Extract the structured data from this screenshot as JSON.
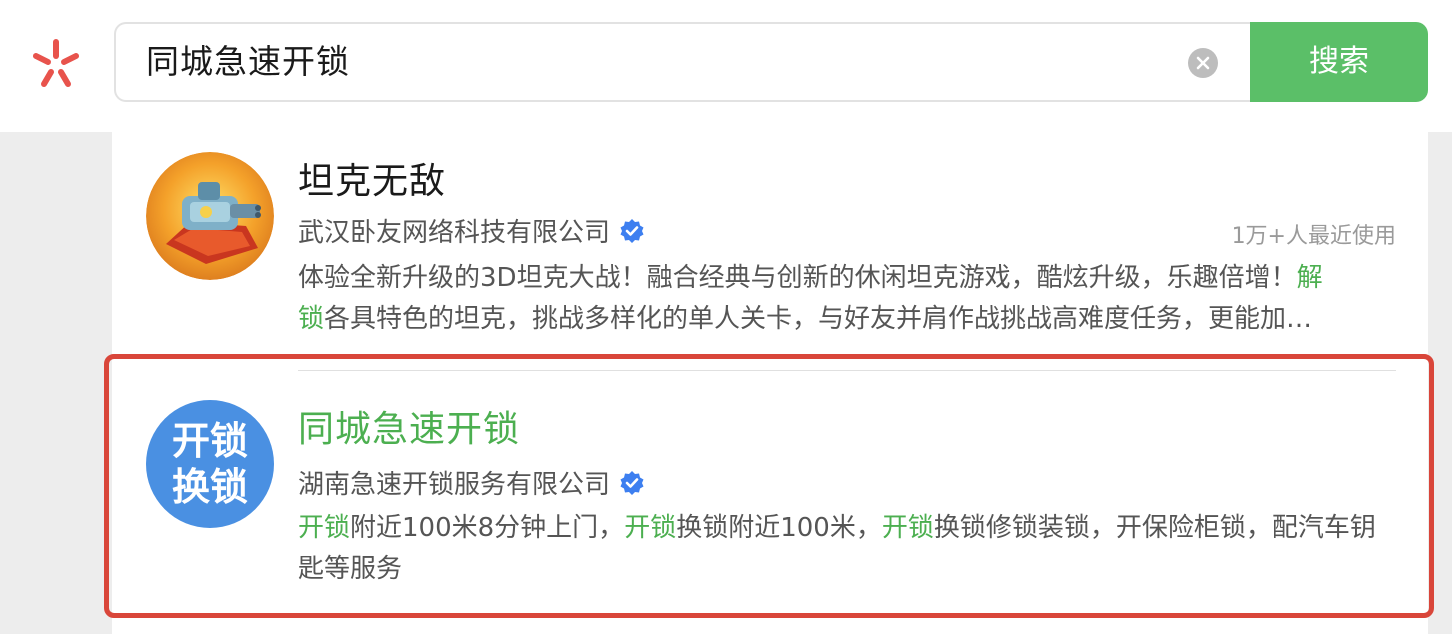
{
  "search": {
    "query": "同城急速开锁",
    "button_label": "搜索"
  },
  "results": [
    {
      "title": "坦克无敌",
      "company": "武汉卧友网络科技有限公司",
      "usage": "1万+人最近使用",
      "desc_line1_pre": "体验全新升级的3D坦克大战！融合经典与创新的休闲坦克游戏，酷炫升级，乐趣倍增！",
      "desc_line1_hl": "解",
      "desc_line2_hl": "锁",
      "desc_line2_post": "各具特色的坦克，挑战多样化的单人关卡，与好友并肩作战挑战高难度任务，更能加…"
    },
    {
      "title": "同城急速开锁",
      "company": "湖南急速开锁服务有限公司",
      "avatar_line1": "开锁",
      "avatar_line2": "换锁",
      "desc_hl1": "开锁",
      "desc_t1": "附近100米8分钟上门，",
      "desc_hl2": "开锁",
      "desc_t2": "换锁附近100米，",
      "desc_hl3": "开锁",
      "desc_t3": "换锁修锁装锁，开保险柜锁，配汽车钥匙等服务"
    }
  ],
  "colors": {
    "accent_green": "#4caf50",
    "button_green": "#5bbf68",
    "highlight_red": "#d9463a",
    "verified_blue": "#3d7ff0"
  },
  "icons": {
    "logo": "asterisk-logo-icon",
    "clear": "clear-icon",
    "verified": "verified-badge-icon"
  }
}
